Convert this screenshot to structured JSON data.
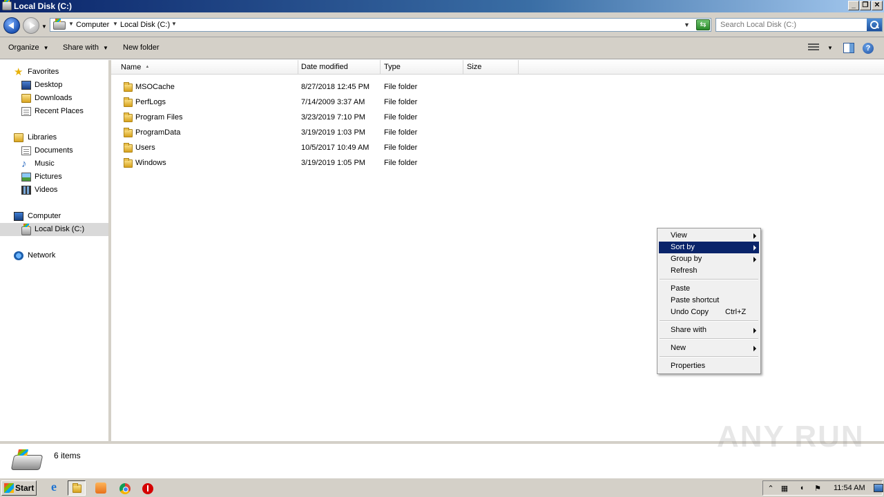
{
  "window": {
    "title": "Local Disk (C:)",
    "controls": {
      "minimize": "_",
      "restore": "❐",
      "close": "✕"
    }
  },
  "address": {
    "crumbs": [
      {
        "label": "Computer"
      },
      {
        "label": "Local Disk (C:)"
      }
    ],
    "search_placeholder": "Search Local Disk (C:)"
  },
  "toolbar": {
    "organize": "Organize",
    "share_with": "Share with",
    "new_folder": "New folder"
  },
  "nav": {
    "favorites": {
      "label": "Favorites",
      "items": [
        "Desktop",
        "Downloads",
        "Recent Places"
      ]
    },
    "libraries": {
      "label": "Libraries",
      "items": [
        "Documents",
        "Music",
        "Pictures",
        "Videos"
      ]
    },
    "computer": {
      "label": "Computer",
      "items": [
        "Local Disk (C:)"
      ]
    },
    "network": {
      "label": "Network"
    }
  },
  "columns": {
    "name": "Name",
    "date": "Date modified",
    "type": "Type",
    "size": "Size"
  },
  "files": [
    {
      "name": "MSOCache",
      "date": "8/27/2018 12:45 PM",
      "type": "File folder"
    },
    {
      "name": "PerfLogs",
      "date": "7/14/2009 3:37 AM",
      "type": "File folder"
    },
    {
      "name": "Program Files",
      "date": "3/23/2019 7:10 PM",
      "type": "File folder"
    },
    {
      "name": "ProgramData",
      "date": "3/19/2019 1:03 PM",
      "type": "File folder"
    },
    {
      "name": "Users",
      "date": "10/5/2017 10:49 AM",
      "type": "File folder"
    },
    {
      "name": "Windows",
      "date": "3/19/2019 1:05 PM",
      "type": "File folder"
    }
  ],
  "context_menu": {
    "items": [
      {
        "label": "View",
        "submenu": true
      },
      {
        "label": "Sort by",
        "submenu": true,
        "highlighted": true
      },
      {
        "label": "Group by",
        "submenu": true
      },
      {
        "label": "Refresh"
      },
      {
        "label": "Paste"
      },
      {
        "label": "Paste shortcut"
      },
      {
        "label": "Undo Copy",
        "shortcut": "Ctrl+Z"
      },
      {
        "label": "Share with",
        "submenu": true
      },
      {
        "label": "New",
        "submenu": true
      },
      {
        "label": "Properties"
      }
    ]
  },
  "status": {
    "item_count": "6 items"
  },
  "watermark": "ANY RUN",
  "taskbar": {
    "start": "Start",
    "clock": "11:54 AM"
  },
  "colors": {
    "menu_highlight": "#0a246a",
    "title_start": "#0a246a",
    "chrome_bg": "#d4d0c8"
  }
}
